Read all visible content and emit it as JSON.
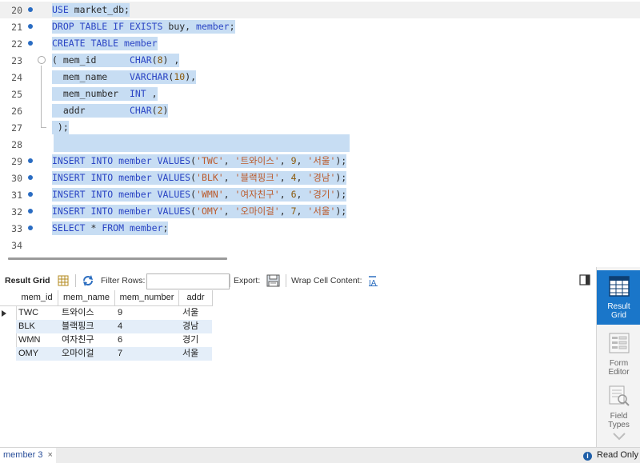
{
  "editor": {
    "lines": [
      {
        "num": "20",
        "parts": [
          {
            "t": "USE ",
            "c": "kw"
          },
          {
            "t": "market_db;",
            "c": "plain"
          }
        ]
      },
      {
        "num": "21",
        "parts": [
          {
            "t": "DROP TABLE IF EXISTS ",
            "c": "kw"
          },
          {
            "t": "buy, ",
            "c": "plain"
          },
          {
            "t": "member",
            "c": "kw"
          },
          {
            "t": ";",
            "c": "plain"
          }
        ]
      },
      {
        "num": "22",
        "parts": [
          {
            "t": "CREATE TABLE ",
            "c": "kw"
          },
          {
            "t": "member",
            "c": "kw"
          }
        ]
      },
      {
        "num": "23",
        "parts": [
          {
            "t": "( mem_id      ",
            "c": "plain"
          },
          {
            "t": "CHAR",
            "c": "fn"
          },
          {
            "t": "(",
            "c": "plain"
          },
          {
            "t": "8",
            "c": "num"
          },
          {
            "t": ") ,",
            "c": "plain"
          }
        ]
      },
      {
        "num": "24",
        "parts": [
          {
            "t": "  mem_name    ",
            "c": "plain"
          },
          {
            "t": "VARCHAR",
            "c": "fn"
          },
          {
            "t": "(",
            "c": "plain"
          },
          {
            "t": "10",
            "c": "num"
          },
          {
            "t": "),",
            "c": "plain"
          }
        ]
      },
      {
        "num": "25",
        "parts": [
          {
            "t": "  mem_number  ",
            "c": "plain"
          },
          {
            "t": "INT",
            "c": "fn"
          },
          {
            "t": " ,",
            "c": "plain"
          }
        ]
      },
      {
        "num": "26",
        "parts": [
          {
            "t": "  addr        ",
            "c": "plain"
          },
          {
            "t": "CHAR",
            "c": "fn"
          },
          {
            "t": "(",
            "c": "plain"
          },
          {
            "t": "2",
            "c": "num"
          },
          {
            "t": ")",
            "c": "plain"
          }
        ]
      },
      {
        "num": "27",
        "parts": [
          {
            "t": " );",
            "c": "plain"
          }
        ]
      },
      {
        "num": "28",
        "parts": []
      },
      {
        "num": "29",
        "parts": [
          {
            "t": "INSERT INTO ",
            "c": "kw"
          },
          {
            "t": "member ",
            "c": "kw"
          },
          {
            "t": "VALUES",
            "c": "kw"
          },
          {
            "t": "(",
            "c": "plain"
          },
          {
            "t": "'TWC'",
            "c": "str"
          },
          {
            "t": ", ",
            "c": "plain"
          },
          {
            "t": "'트와이스'",
            "c": "str"
          },
          {
            "t": ", ",
            "c": "plain"
          },
          {
            "t": "9",
            "c": "num"
          },
          {
            "t": ", ",
            "c": "plain"
          },
          {
            "t": "'서울'",
            "c": "str"
          },
          {
            "t": ");",
            "c": "plain"
          }
        ]
      },
      {
        "num": "30",
        "parts": [
          {
            "t": "INSERT INTO ",
            "c": "kw"
          },
          {
            "t": "member ",
            "c": "kw"
          },
          {
            "t": "VALUES",
            "c": "kw"
          },
          {
            "t": "(",
            "c": "plain"
          },
          {
            "t": "'BLK'",
            "c": "str"
          },
          {
            "t": ", ",
            "c": "plain"
          },
          {
            "t": "'블랙핑크'",
            "c": "str"
          },
          {
            "t": ", ",
            "c": "plain"
          },
          {
            "t": "4",
            "c": "num"
          },
          {
            "t": ", ",
            "c": "plain"
          },
          {
            "t": "'경남'",
            "c": "str"
          },
          {
            "t": ");",
            "c": "plain"
          }
        ]
      },
      {
        "num": "31",
        "parts": [
          {
            "t": "INSERT INTO ",
            "c": "kw"
          },
          {
            "t": "member ",
            "c": "kw"
          },
          {
            "t": "VALUES",
            "c": "kw"
          },
          {
            "t": "(",
            "c": "plain"
          },
          {
            "t": "'WMN'",
            "c": "str"
          },
          {
            "t": ", ",
            "c": "plain"
          },
          {
            "t": "'여자친구'",
            "c": "str"
          },
          {
            "t": ", ",
            "c": "plain"
          },
          {
            "t": "6",
            "c": "num"
          },
          {
            "t": ", ",
            "c": "plain"
          },
          {
            "t": "'경기'",
            "c": "str"
          },
          {
            "t": ");",
            "c": "plain"
          }
        ]
      },
      {
        "num": "32",
        "parts": [
          {
            "t": "INSERT INTO ",
            "c": "kw"
          },
          {
            "t": "member ",
            "c": "kw"
          },
          {
            "t": "VALUES",
            "c": "kw"
          },
          {
            "t": "(",
            "c": "plain"
          },
          {
            "t": "'OMY'",
            "c": "str"
          },
          {
            "t": ", ",
            "c": "plain"
          },
          {
            "t": "'오마이걸'",
            "c": "str"
          },
          {
            "t": ", ",
            "c": "plain"
          },
          {
            "t": "7",
            "c": "num"
          },
          {
            "t": ", ",
            "c": "plain"
          },
          {
            "t": "'서울'",
            "c": "str"
          },
          {
            "t": ");",
            "c": "plain"
          }
        ]
      },
      {
        "num": "33",
        "parts": [
          {
            "t": "SELECT ",
            "c": "kw"
          },
          {
            "t": "* ",
            "c": "plain"
          },
          {
            "t": "FROM ",
            "c": "kw"
          },
          {
            "t": "member",
            "c": "kw"
          },
          {
            "t": ";",
            "c": "plain"
          }
        ]
      },
      {
        "num": "34",
        "parts": []
      }
    ]
  },
  "toolbar": {
    "result_grid_label": "Result Grid",
    "filter_rows_label": "Filter Rows:",
    "filter_value": "",
    "export_label": "Export:",
    "wrap_label": "Wrap Cell Content:"
  },
  "grid": {
    "columns": [
      "mem_id",
      "mem_name",
      "mem_number",
      "addr"
    ],
    "rows": [
      [
        "TWC",
        "트와이스",
        "9",
        "서울"
      ],
      [
        "BLK",
        "블랙핑크",
        "4",
        "경남"
      ],
      [
        "WMN",
        "여자친구",
        "6",
        "경기"
      ],
      [
        "OMY",
        "오마이걸",
        "7",
        "서울"
      ]
    ]
  },
  "side_panel": {
    "result_grid": [
      "Result",
      "Grid"
    ],
    "form_editor": [
      "Form",
      "Editor"
    ],
    "field_types": [
      "Field",
      "Types"
    ]
  },
  "status": {
    "tab_label": "member 3",
    "tab_close": "×",
    "read_only": "Read Only",
    "info_glyph": "i"
  },
  "colors": {
    "selection": "#c7ddf3",
    "keyword": "#2b45c4",
    "string": "#bb5a2b",
    "accent": "#1a76c9"
  }
}
